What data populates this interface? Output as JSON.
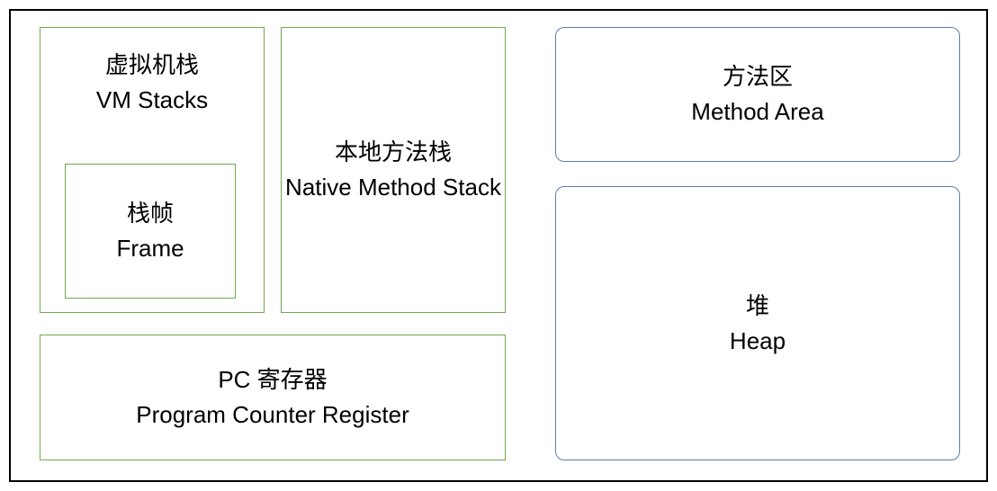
{
  "vm_stacks": {
    "cn": "虚拟机栈",
    "en": "VM Stacks"
  },
  "frame": {
    "cn": "栈帧",
    "en": "Frame"
  },
  "native_stack": {
    "cn": "本地方法栈",
    "en": "Native Method Stack"
  },
  "pc_register": {
    "cn": "PC  寄存器",
    "en": "Program Counter Register"
  },
  "method_area": {
    "cn": "方法区",
    "en": "Method Area"
  },
  "heap": {
    "cn": "堆",
    "en": "Heap"
  },
  "colors": {
    "green_border": "#6fa84f",
    "blue_border": "#5b7fa8",
    "outer_border": "#000000"
  }
}
